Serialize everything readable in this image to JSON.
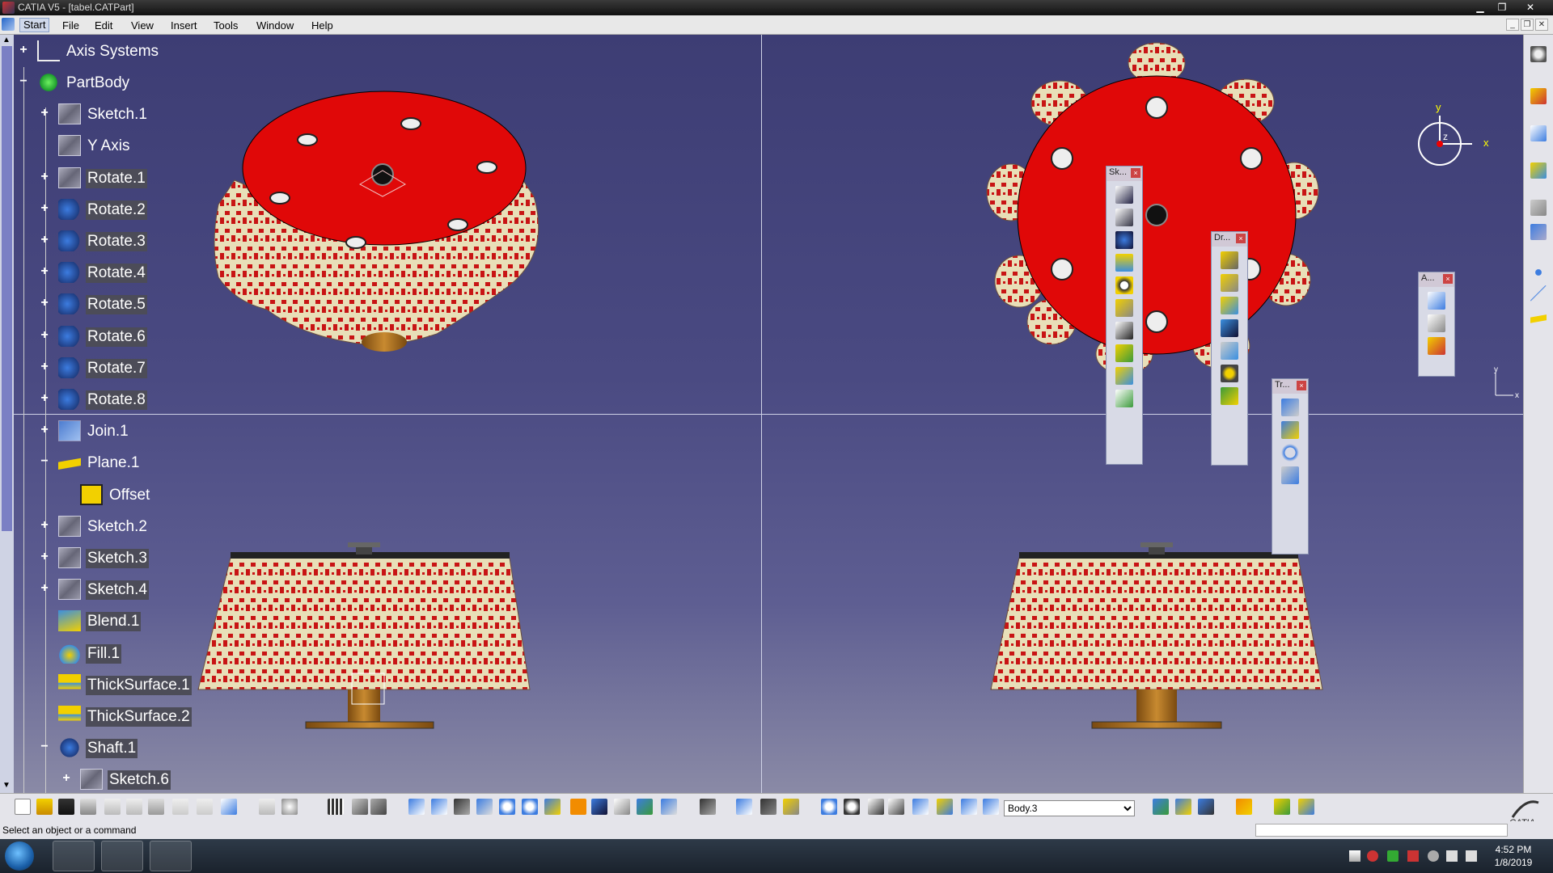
{
  "window": {
    "title": "CATIA V5 - [tabel.CATPart]",
    "min": "▁",
    "max": "❐",
    "close": "✕"
  },
  "menu": {
    "items": [
      "Start",
      "File",
      "Edit",
      "View",
      "Insert",
      "Tools",
      "Window",
      "Help"
    ]
  },
  "tree": {
    "nodes": [
      {
        "label": "Axis Systems",
        "icon": "axis-system-icon",
        "expander": "+"
      },
      {
        "label": "PartBody",
        "icon": "part-body-icon",
        "expander": "−"
      },
      {
        "label": "Sketch.1",
        "icon": "sketch-icon",
        "expander": "+"
      },
      {
        "label": "Y Axis",
        "icon": "sketch-icon",
        "expander": ""
      },
      {
        "label": "Rotate.1",
        "icon": "sketch-icon",
        "expander": "+"
      },
      {
        "label": "Rotate.2",
        "icon": "rotate-icon",
        "expander": "+"
      },
      {
        "label": "Rotate.3",
        "icon": "rotate-icon",
        "expander": "+"
      },
      {
        "label": "Rotate.4",
        "icon": "rotate-icon",
        "expander": "+"
      },
      {
        "label": "Rotate.5",
        "icon": "rotate-icon",
        "expander": "+"
      },
      {
        "label": "Rotate.6",
        "icon": "rotate-icon",
        "expander": "+"
      },
      {
        "label": "Rotate.7",
        "icon": "rotate-icon",
        "expander": "+"
      },
      {
        "label": "Rotate.8",
        "icon": "rotate-icon",
        "expander": "+"
      },
      {
        "label": "Join.1",
        "icon": "join-icon",
        "expander": "+"
      },
      {
        "label": "Plane.1",
        "icon": "plane-icon",
        "expander": "−"
      },
      {
        "label": "Offset",
        "icon": "offset-icon",
        "expander": ""
      },
      {
        "label": "Sketch.2",
        "icon": "sketch-icon",
        "expander": "+"
      },
      {
        "label": "Sketch.3",
        "icon": "sketch-icon",
        "expander": "+"
      },
      {
        "label": "Sketch.4",
        "icon": "sketch-icon",
        "expander": "+"
      },
      {
        "label": "Blend.1",
        "icon": "blend-icon",
        "expander": ""
      },
      {
        "label": "Fill.1",
        "icon": "fill-icon",
        "expander": ""
      },
      {
        "label": "ThickSurface.1",
        "icon": "thick-surface-icon",
        "expander": ""
      },
      {
        "label": "ThickSurface.2",
        "icon": "thick-surface-icon",
        "expander": ""
      },
      {
        "label": "Shaft.1",
        "icon": "shaft-icon",
        "expander": "−"
      },
      {
        "label": "Sketch.6",
        "icon": "sketch-icon",
        "expander": "+"
      }
    ]
  },
  "floating_toolbars": {
    "sketch": {
      "title": "Sk..."
    },
    "dress": {
      "title": "Dr..."
    },
    "transform": {
      "title": "Tr..."
    },
    "annotation": {
      "title": "A..."
    }
  },
  "compass": {
    "x_label": "x",
    "y_label": "y",
    "z_label": "z"
  },
  "axis_triad": {
    "x_label": "x",
    "y_label": "y"
  },
  "bottom_toolbar": {
    "body_select": "Body.3"
  },
  "status": {
    "text": "Select an object or a command"
  },
  "taskbar": {
    "time": "4:52 PM",
    "date": "1/8/2019"
  }
}
